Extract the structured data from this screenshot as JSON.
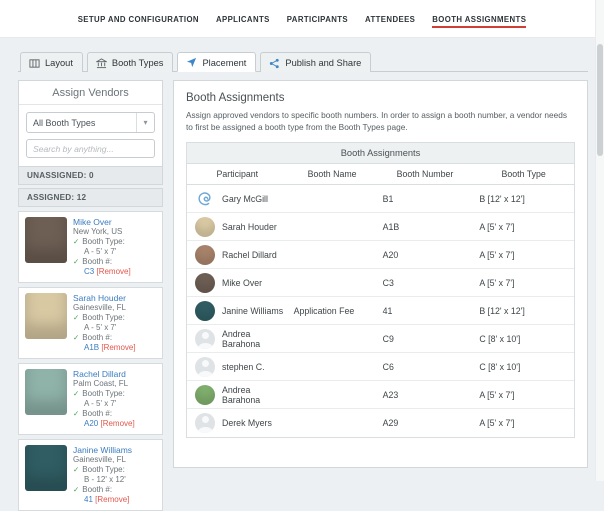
{
  "nav": {
    "items": [
      "SETUP AND CONFIGURATION",
      "APPLICANTS",
      "PARTICIPANTS",
      "ATTENDEES",
      "BOOTH ASSIGNMENTS"
    ]
  },
  "tabs": [
    "Layout",
    "Booth Types",
    "Placement",
    "Publish and Share"
  ],
  "sidebar": {
    "title": "Assign Vendors",
    "booth_type_filter": "All Booth Types",
    "search_placeholder": "Search by anything...",
    "unassigned": "UNASSIGNED: 0",
    "assigned": "ASSIGNED: 12",
    "labels": {
      "booth_type": "Booth Type:",
      "booth_number": "Booth #:",
      "remove": "[Remove]"
    },
    "vendors": [
      {
        "name": "Mike Over",
        "location": "New York, US",
        "booth_type": "A - 5' x 7'",
        "booth_number": "C3",
        "avatar_color": "#6e5f54"
      },
      {
        "name": "Sarah Houder",
        "location": "Gainesville, FL",
        "booth_type": "A - 5' x 7'",
        "booth_number": "A1B",
        "avatar_color": "#d9c9a3"
      },
      {
        "name": "Rachel Dillard",
        "location": "Palm Coast, FL",
        "booth_type": "A - 5' x 7'",
        "booth_number": "A20",
        "avatar_color": "#8fb3a9"
      },
      {
        "name": "Janine Williams",
        "location": "Gainesville, FL",
        "booth_type": "B - 12' x 12'",
        "booth_number": "41",
        "avatar_color": "#2f5d63"
      }
    ]
  },
  "main": {
    "title": "Booth Assignments",
    "description": "Assign approved vendors to specific booth numbers. In order to assign a booth number, a vendor needs to first be assigned a booth type from the Booth Types page.",
    "table": {
      "caption": "Booth Assignments",
      "columns": [
        "Participant",
        "Booth Name",
        "Booth Number",
        "Booth Type"
      ],
      "rows": [
        {
          "participant": "Gary McGill",
          "booth_name": "",
          "booth_number": "B1",
          "booth_type": "B [12' x 12']",
          "avatar_color": "#ffffff"
        },
        {
          "participant": "Sarah Houder",
          "booth_name": "",
          "booth_number": "A1B",
          "booth_type": "A [5' x 7']",
          "avatar_color": "#d9c9a3"
        },
        {
          "participant": "Rachel Dillard",
          "booth_name": "",
          "booth_number": "A20",
          "booth_type": "A [5' x 7']",
          "avatar_color": "#a8836b"
        },
        {
          "participant": "Mike Over",
          "booth_name": "",
          "booth_number": "C3",
          "booth_type": "A [5' x 7']",
          "avatar_color": "#6e5f54"
        },
        {
          "participant": "Janine Williams",
          "booth_name": "Application Fee",
          "booth_number": "41",
          "booth_type": "B [12' x 12']",
          "avatar_color": "#2f5d63"
        },
        {
          "participant": "Andrea Barahona",
          "booth_name": "",
          "booth_number": "C9",
          "booth_type": "C [8' x 10']",
          "avatar_color": "#dfe3e5"
        },
        {
          "participant": "stephen C.",
          "booth_name": "",
          "booth_number": "C6",
          "booth_type": "C [8' x 10']",
          "avatar_color": "#dfe3e5"
        },
        {
          "participant": "Andrea Barahona",
          "booth_name": "",
          "booth_number": "A23",
          "booth_type": "A [5' x 7']",
          "avatar_color": "#7fae6d"
        },
        {
          "participant": "Derek Myers",
          "booth_name": "",
          "booth_number": "A29",
          "booth_type": "A [5' x 7']",
          "avatar_color": "#dfe3e5"
        }
      ]
    }
  },
  "colors": {
    "active_nav_underline": "#cf3f36",
    "link_blue": "#3a7cc0",
    "check_green": "#3fa24c",
    "remove_red": "#e2574c"
  }
}
